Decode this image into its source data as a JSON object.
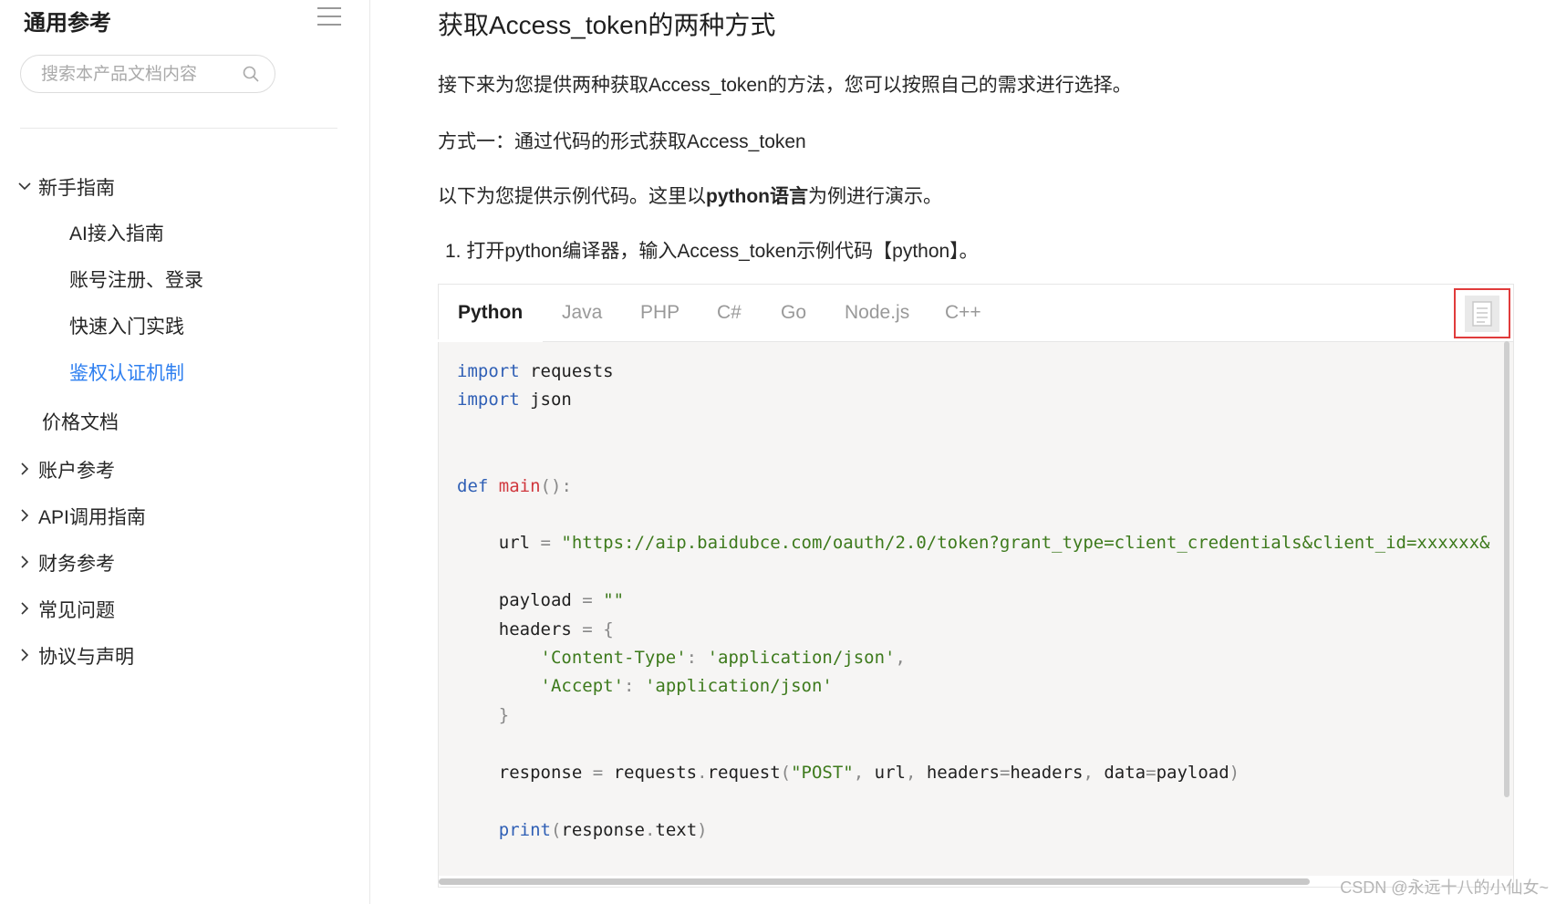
{
  "sidebar": {
    "title": "通用参考",
    "search": {
      "placeholder": "搜索本产品文档内容",
      "value": ""
    },
    "items": [
      {
        "label": "新手指南",
        "expanded": true
      },
      {
        "label": "AI接入指南"
      },
      {
        "label": "账号注册、登录"
      },
      {
        "label": "快速入门实践"
      },
      {
        "label": "鉴权认证机制",
        "active": true
      },
      {
        "label": "价格文档"
      },
      {
        "label": "账户参考",
        "expanded": false
      },
      {
        "label": "API调用指南",
        "expanded": false
      },
      {
        "label": "财务参考",
        "expanded": false
      },
      {
        "label": "常见问题",
        "expanded": false
      },
      {
        "label": "协议与声明",
        "expanded": false
      }
    ]
  },
  "main": {
    "title": "获取Access_token的两种方式",
    "intro": "接下来为您提供两种获取Access_token的方法，您可以按照自己的需求进行选择。",
    "method1": "方式一：通过代码的形式获取Access_token",
    "example_prefix": "以下为您提供示例代码。这里以",
    "example_bold": "python语言",
    "example_suffix": "为例进行演示。",
    "step1": "1. 打开python编译器，输入Access_token示例代码【python】。",
    "tabs": [
      "Python",
      "Java",
      "PHP",
      "C#",
      "Go",
      "Node.js",
      "C++"
    ],
    "active_tab": "Python",
    "code_lines": [
      "import requests",
      "import json",
      "",
      "",
      "def main():",
      "",
      "    url = \"https://aip.baidubce.com/oauth/2.0/token?grant_type=client_credentials&client_id=xxxxxx&",
      "",
      "    payload = \"\"",
      "    headers = {",
      "        'Content-Type': 'application/json',",
      "        'Accept': 'application/json'",
      "    }",
      "",
      "    response = requests.request(\"POST\", url, headers=headers, data=payload)",
      "",
      "    print(response.text)"
    ]
  },
  "watermark": "CSDN @永远十八的小仙女~",
  "colors": {
    "accent": "#2e7ff0",
    "copy_highlight": "#e03b3b",
    "keyword": "#2f5fb5",
    "string": "#3d7a1c"
  }
}
